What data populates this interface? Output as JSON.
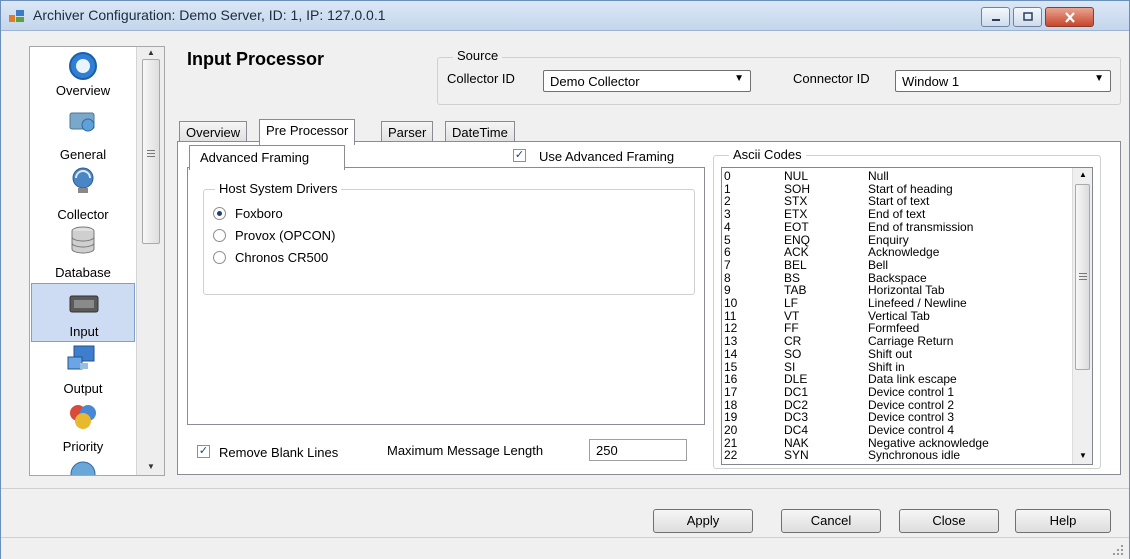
{
  "window": {
    "title": "Archiver Configuration: Demo Server, ID: 1, IP: 127.0.0.1",
    "accent": "#1f3f7a"
  },
  "nav": {
    "items": [
      {
        "label": "Overview",
        "icon": "overview-icon"
      },
      {
        "label": "General",
        "icon": "general-icon"
      },
      {
        "label": "Collector",
        "icon": "collector-icon"
      },
      {
        "label": "Database",
        "icon": "database-icon"
      },
      {
        "label": "Input",
        "icon": "input-icon",
        "selected": true
      },
      {
        "label": "Output",
        "icon": "output-icon"
      },
      {
        "label": "Priority",
        "icon": "priority-icon"
      }
    ]
  },
  "header": {
    "title": "Input Processor",
    "source_label": "Source",
    "collector_id_label": "Collector ID",
    "collector_id_value": "Demo Collector",
    "connector_id_label": "Connector ID",
    "connector_id_value": "Window 1"
  },
  "tabs": [
    "Overview",
    "Pre Processor",
    "Parser",
    "DateTime"
  ],
  "active_tab": "Pre Processor",
  "pre_processor": {
    "inner_tab": "Advanced Framing",
    "use_advanced_framing_label": "Use Advanced Framing",
    "use_advanced_framing": true,
    "host_group_label": "Host System Drivers",
    "drivers": [
      {
        "label": "Foxboro",
        "selected": true
      },
      {
        "label": "Provox (OPCON)",
        "selected": false
      },
      {
        "label": "Chronos CR500",
        "selected": false
      }
    ],
    "remove_blank_lines_label": "Remove Blank Lines",
    "remove_blank_lines": true,
    "max_length_label": "Maximum Message Length",
    "max_length_value": "250"
  },
  "ascii": {
    "label": "Ascii Codes",
    "rows": [
      [
        "0",
        "NUL",
        "Null"
      ],
      [
        "1",
        "SOH",
        "Start of heading"
      ],
      [
        "2",
        "STX",
        "Start of text"
      ],
      [
        "3",
        "ETX",
        "End of text"
      ],
      [
        "4",
        "EOT",
        "End of transmission"
      ],
      [
        "5",
        "ENQ",
        "Enquiry"
      ],
      [
        "6",
        "ACK",
        "Acknowledge"
      ],
      [
        "7",
        "BEL",
        "Bell"
      ],
      [
        "8",
        "BS",
        "Backspace"
      ],
      [
        "9",
        "TAB",
        "Horizontal Tab"
      ],
      [
        "10",
        "LF",
        "Linefeed / Newline"
      ],
      [
        "11",
        "VT",
        "Vertical Tab"
      ],
      [
        "12",
        "FF",
        "Formfeed"
      ],
      [
        "13",
        "CR",
        "Carriage Return"
      ],
      [
        "14",
        "SO",
        "Shift out"
      ],
      [
        "15",
        "SI",
        "Shift in"
      ],
      [
        "16",
        "DLE",
        "Data link escape"
      ],
      [
        "17",
        "DC1",
        "Device control 1"
      ],
      [
        "18",
        "DC2",
        "Device control 2"
      ],
      [
        "19",
        "DC3",
        "Device control 3"
      ],
      [
        "20",
        "DC4",
        "Device control 4"
      ],
      [
        "21",
        "NAK",
        "Negative acknowledge"
      ],
      [
        "22",
        "SYN",
        "Synchronous idle"
      ]
    ]
  },
  "buttons": {
    "apply": "Apply",
    "cancel": "Cancel",
    "close": "Close",
    "help": "Help"
  }
}
